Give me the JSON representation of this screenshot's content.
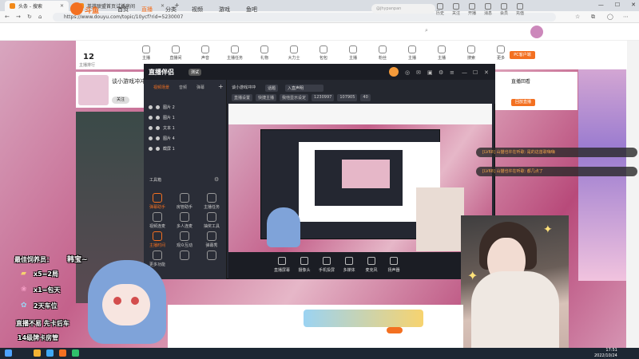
{
  "browser": {
    "tabs": [
      {
        "title": "头条 - 搜索"
      },
      {
        "title": "英雄联盟首页试播房间"
      }
    ],
    "url": "https://www.douyu.com/topic/10ycf?rid=5230007"
  },
  "site": {
    "logo": "斗鱼",
    "nav": [
      "首页",
      "直播",
      "分类",
      "视频",
      "游戏",
      "鱼吧"
    ],
    "search_placeholder": "@jhypanpan",
    "header_icons": [
      "历史",
      "关注",
      "开播",
      "消息",
      "会员",
      "充值"
    ]
  },
  "room": {
    "number": "12",
    "number_label": "主播排行",
    "title": "谈小游戏冲冲",
    "follow": "关注",
    "pc_button": "PC客户端",
    "toolbar": [
      "主播",
      "直播间",
      "声音",
      "主播任务",
      "礼物",
      "大力士",
      "包包",
      "主播",
      "粉丝",
      "主播",
      "主播",
      "搜索",
      "更多"
    ],
    "right_panel_title": "直播回看",
    "right_panel_btn": "回放直播"
  },
  "app": {
    "name": "直播伴侣",
    "version": "测试",
    "side_tabs": [
      "视频场景",
      "音频",
      "弹幕"
    ],
    "layers": [
      "图片 2",
      "图片 1",
      "文本 1",
      "图片 4",
      "截屏 1"
    ],
    "tools_label": "工具箱",
    "tools": [
      {
        "label": "弹幕助手",
        "on": true
      },
      {
        "label": "房管助手",
        "on": false
      },
      {
        "label": "主播任务",
        "on": false
      },
      {
        "label": "视频连麦",
        "on": false
      },
      {
        "label": "多人连麦",
        "on": false
      },
      {
        "label": "抽奖工具",
        "on": false
      },
      {
        "label": "主播时间",
        "on": true
      },
      {
        "label": "观众互动",
        "on": false
      },
      {
        "label": "弹幕秀",
        "on": false
      },
      {
        "label": "更多功能",
        "on": false
      },
      {
        "label": "",
        "on": false
      },
      {
        "label": "",
        "on": false
      }
    ],
    "room_title": "谈小游戏冲冲",
    "topic": "话题",
    "notice": "入直声明",
    "chips": [
      "直播设置",
      "快捷主播",
      "我他显示设定",
      "1230997",
      "107905",
      "40"
    ],
    "bottom_buttons": [
      "直播屏幕",
      "摄像头",
      "手机投屏",
      "多媒体",
      "麦克风",
      "扬声器"
    ]
  },
  "chat": [
    "[LV68] 山猫也许在听歌: 是的这首歌嗨嗨",
    "[LV68] 山猫也许在听歌: 都几点了"
  ],
  "stickers": {
    "heading": "最佳饲养员：",
    "name": "韩宝~",
    "lines": [
      "x5=2局",
      "x1=包天",
      "2天车位",
      "直播不易 先卡后车",
      "14级牌卡房管"
    ]
  },
  "taskbar": {
    "time": "17:51",
    "date": "2022/10/24"
  }
}
